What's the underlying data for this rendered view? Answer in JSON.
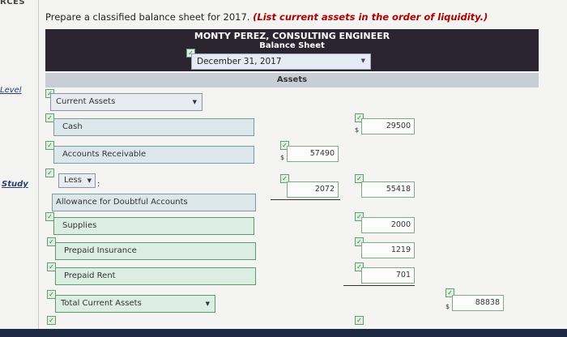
{
  "app": {
    "gutter_title": "RCES",
    "level_link": "Level",
    "study_link": "Study"
  },
  "instruction": {
    "text": "Prepare a classified balance sheet for 2017.",
    "hint": "(List current assets in the order of liquidity.)"
  },
  "header": {
    "company": "MONTY PEREZ, CONSULTING ENGINEER",
    "statement": "Balance Sheet",
    "date_value": "December 31, 2017",
    "section": "Assets"
  },
  "rows": {
    "current_assets": "Current Assets",
    "cash": "Cash",
    "cash_amount": "29500",
    "accounts_receivable": "Accounts Receivable",
    "ar_amount": "57490",
    "less_select": "Less",
    "allowance": "Allowance for Doubtful Accounts",
    "allowance_amount": "2072",
    "net_ar_amount": "55418",
    "supplies": "Supplies",
    "supplies_amount": "2000",
    "prepaid_insurance": "Prepaid Insurance",
    "prepaid_insurance_amount": "1219",
    "prepaid_rent": "Prepaid Rent",
    "prepaid_rent_amount": "701",
    "total_current_assets": "Total Current Assets",
    "total_amount": "88838"
  },
  "symbols": {
    "dollar": "$",
    "colon": ":",
    "check": "✓",
    "caret": "▼"
  },
  "colors": {
    "header_bg": "#2a2530",
    "hint": "#b00000",
    "field_bg": "#dbe7ea"
  }
}
